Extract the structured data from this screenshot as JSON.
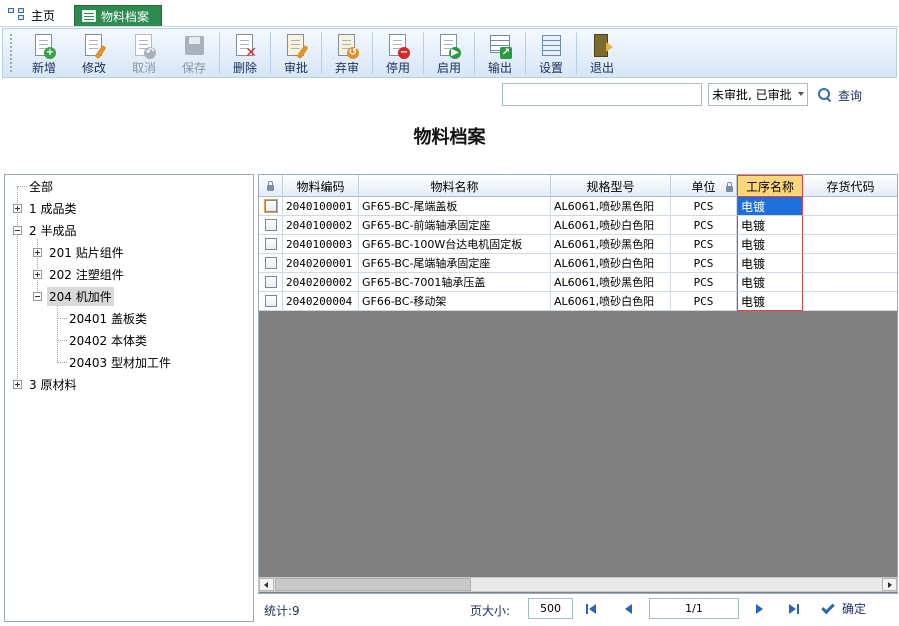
{
  "tabs": {
    "home": "主页",
    "active": "物料档案"
  },
  "toolbar": [
    {
      "label": "新增",
      "icon": "add-icon",
      "disabled": false
    },
    {
      "label": "修改",
      "icon": "edit-icon",
      "disabled": false
    },
    {
      "label": "取消",
      "icon": "undo-icon",
      "disabled": true
    },
    {
      "label": "保存",
      "icon": "save-icon",
      "disabled": true
    },
    {
      "label": "删除",
      "icon": "delete-icon",
      "disabled": false
    },
    {
      "label": "审批",
      "icon": "approve-icon",
      "disabled": false
    },
    {
      "label": "弃审",
      "icon": "unapprove-icon",
      "disabled": false
    },
    {
      "label": "停用",
      "icon": "stop-icon",
      "disabled": false
    },
    {
      "label": "启用",
      "icon": "enable-icon",
      "disabled": false
    },
    {
      "label": "输出",
      "icon": "export-icon",
      "disabled": false
    },
    {
      "label": "设置",
      "icon": "settings-icon",
      "disabled": false
    },
    {
      "label": "退出",
      "icon": "exit-icon",
      "disabled": false
    }
  ],
  "search": {
    "value": "",
    "status_selected": "未审批, 已审批",
    "query_label": "查询"
  },
  "page_title": "物料档案",
  "tree": {
    "root": "全部",
    "n1": "1 成品类",
    "n2": "2 半成品",
    "n201": "201 贴片组件",
    "n202": "202 注塑组件",
    "n204": "204 机加件",
    "n20401": "20401 盖板类",
    "n20402": "20402 本体类",
    "n20403": "20403 型材加工件",
    "n3": "3 原材料"
  },
  "grid": {
    "columns": [
      "物料编码",
      "物料名称",
      "规格型号",
      "单位",
      "工序名称",
      "存货代码"
    ],
    "rows": [
      {
        "code": "2040100001",
        "name": "GF65-BC-尾端盖板",
        "spec": "AL6061,喷砂黑色阳",
        "unit": "PCS",
        "process": "电镀",
        "inv": ""
      },
      {
        "code": "2040100002",
        "name": "GF65-BC-前端轴承固定座",
        "spec": "AL6061,喷砂白色阳",
        "unit": "PCS",
        "process": "电镀",
        "inv": ""
      },
      {
        "code": "2040100003",
        "name": "GF65-BC-100W台达电机固定板",
        "spec": "AL6061,喷砂黑色阳",
        "unit": "PCS",
        "process": "电镀",
        "inv": ""
      },
      {
        "code": "2040200001",
        "name": "GF65-BC-尾端轴承固定座",
        "spec": "AL6061,喷砂白色阳",
        "unit": "PCS",
        "process": "电镀",
        "inv": ""
      },
      {
        "code": "2040200002",
        "name": "GF65-BC-7001轴承压盖",
        "spec": "AL6061,喷砂黑色阳",
        "unit": "PCS",
        "process": "电镀",
        "inv": ""
      },
      {
        "code": "2040200004",
        "name": "GF66-BC-移动架",
        "spec": "AL6061,喷砂白色阳",
        "unit": "PCS",
        "process": "电镀",
        "inv": ""
      }
    ]
  },
  "footer": {
    "count": "统计:9",
    "page_size_label": "页大小:",
    "page_size": "500",
    "page_info": "1/1",
    "confirm_label": "确定"
  },
  "colors": {
    "tab_active": "#2d8b4f",
    "selected_cell": "#1e6fd9",
    "highlight_header": "#ffd77a",
    "highlight_border": "#e04343",
    "grid_empty": "#808080"
  }
}
